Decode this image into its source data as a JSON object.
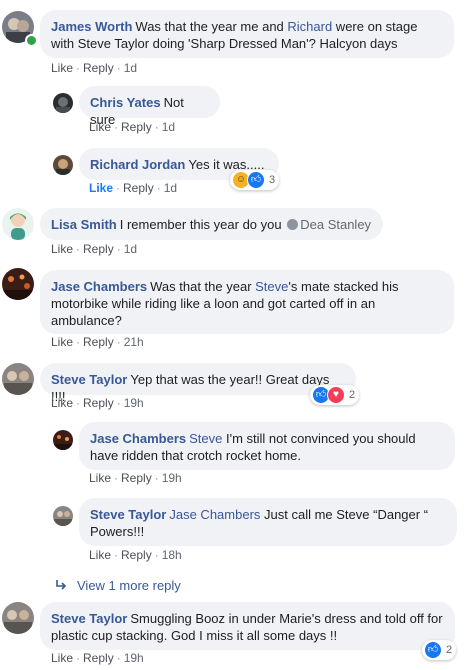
{
  "actions": {
    "like": "Like",
    "reply": "Reply",
    "separator": "·"
  },
  "comments": [
    {
      "author": "James Worth",
      "text_before": "Was that the year me and ",
      "mention": "Richard",
      "text_after": " were on stage with Steve Taylor doing 'Sharp Dressed Man'? Halcyon days",
      "time": "1d"
    },
    {
      "author": "Chris Yates",
      "text": "Not sure",
      "time": "1d"
    },
    {
      "author": "Richard Jordan",
      "text": "Yes it was.....",
      "time": "1d",
      "reaction_count": "3"
    },
    {
      "author": "Lisa Smith",
      "text": "I remember this year do you",
      "mention": "Dea Stanley",
      "time": "1d"
    },
    {
      "author": "Jase Chambers",
      "text_before": "Was that the year ",
      "mention": "Steve",
      "text_after": "'s mate stacked his motorbike while riding like a loon and got carted off in an ambulance?",
      "time": "21h"
    },
    {
      "author": "Steve Taylor",
      "text": "Yep that was the year!! Great days !!!!",
      "time": "19h",
      "reaction_count": "2"
    },
    {
      "author": "Jase Chambers",
      "mention": "Steve",
      "text": " I'm still not convinced you should have ridden that crotch rocket home.",
      "time": "19h"
    },
    {
      "author": "Steve Taylor",
      "mention": "Jase Chambers",
      "text": " Just call me Steve “Danger “ Powers!!!",
      "time": "18h"
    },
    {
      "author": "Steve Taylor",
      "text": "Smuggling Booz in under Marie's dress and told off for plastic cup stacking. God I miss it all some days !!",
      "time": "19h",
      "reaction_count": "2"
    }
  ],
  "view_more": "View 1 more reply",
  "icons": {
    "like": "like-icon",
    "love": "love-icon",
    "haha": "haha-icon",
    "reply_arrow": "reply-arrow-icon"
  },
  "colors": {
    "link": "#385898",
    "bubble": "#f0f2f5",
    "like_active": "#2078f4"
  }
}
